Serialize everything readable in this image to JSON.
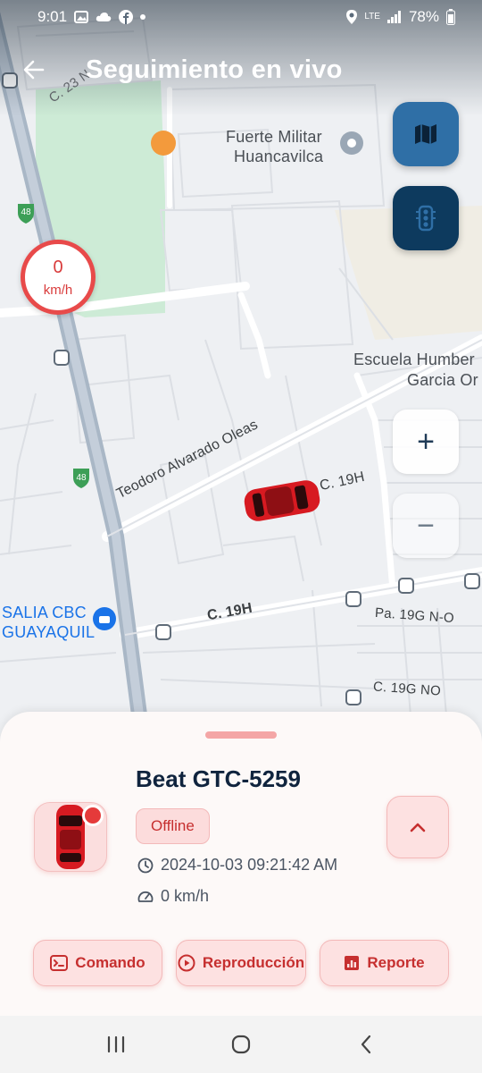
{
  "status_bar": {
    "time": "9:01",
    "network": "LTE",
    "battery": "78%"
  },
  "header": {
    "title": "Seguimiento en vivo"
  },
  "map": {
    "labels": {
      "street_c23": "C. 23 N",
      "poi_fuerte_line1": "Fuerte Militar",
      "poi_fuerte_line2": "Huancavilca",
      "road_48_top": "48",
      "road_48_bottom": "48",
      "school_line1": "Escuela Humber",
      "school_line2": "Garcia Or",
      "teodoro": "Teodoro Alvarado Oleas",
      "c19h_upper": "C. 19H",
      "c19h_lower": "C. 19H",
      "salia_line1": "SALIA CBC",
      "salia_line2": "GUAYAQUIL",
      "pa19g": "Pa. 19G N-O",
      "c19g": "C. 19G NO"
    },
    "speed_gauge": {
      "value": "0",
      "unit": "km/h"
    },
    "zoom_in": "+",
    "zoom_out": "−"
  },
  "vehicle": {
    "name": "Beat GTC-5259",
    "status": "Offline",
    "timestamp": "2024-10-03 09:21:42 AM",
    "speed": "0 km/h"
  },
  "actions": {
    "comando": "Comando",
    "reproduccion": "Reproducción",
    "reporte": "Reporte"
  },
  "colors": {
    "accent": "#e53a3a",
    "map_button": "#2f6fa6",
    "traffic_button": "#0d3a5e",
    "title_text": "#10243e"
  }
}
